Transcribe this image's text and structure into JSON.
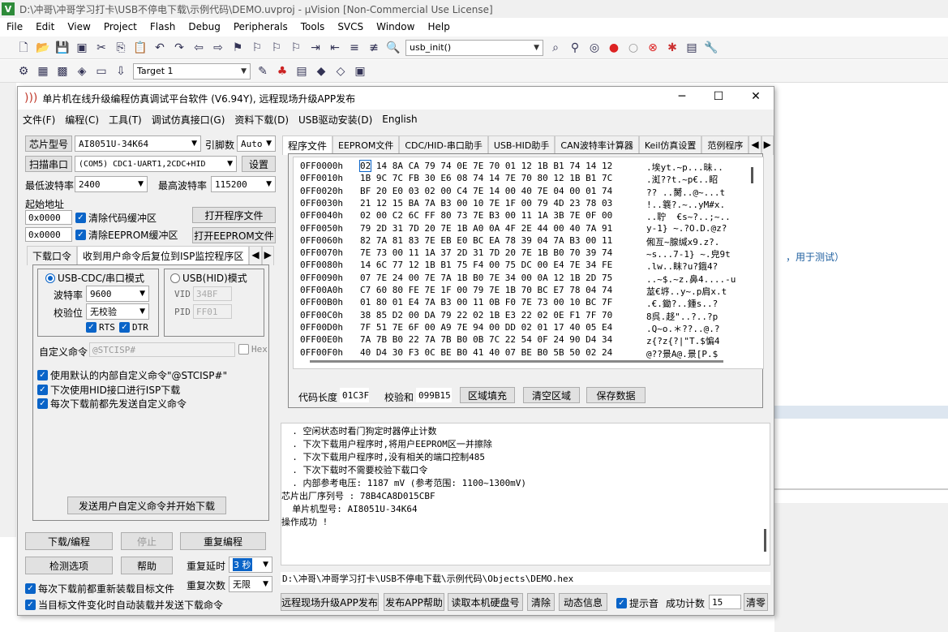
{
  "uvision": {
    "title": "D:\\冲哥\\冲哥学习打卡\\USB不停电下载\\示例代码\\DEMO.uvproj - µVision  [Non-Commercial Use License]",
    "menu": [
      "File",
      "Edit",
      "View",
      "Project",
      "Flash",
      "Debug",
      "Peripherals",
      "Tools",
      "SVCS",
      "Window",
      "Help"
    ],
    "func_combo": "usb_init()",
    "target": "Target 1",
    "right_note": "，用于测试）"
  },
  "isp": {
    "title": "单片机在线升级编程仿真调试平台软件 (V6.94Y), 远程现场升级APP发布",
    "menu": [
      "文件(F)",
      "编程(C)",
      "工具(T)",
      "调试仿真接口(G)",
      "资料下载(D)",
      "USB驱动安装(D)",
      "English"
    ],
    "chip_btn": "芯片型号",
    "chip_value": "AI8051U-34K64",
    "pins_label": "引脚数",
    "pins_value": "Auto",
    "scan_btn": "扫描串口",
    "port_value": "(COM5) CDC1-UART1,2CDC+HID",
    "settings_btn": "设置",
    "min_baud_label": "最低波特率",
    "min_baud": "2400",
    "max_baud_label": "最高波特率",
    "max_baud": "115200",
    "start_addr_label": "起始地址",
    "addr1": "0x0000",
    "clear_code": "清除代码缓冲区",
    "open_prog": "打开程序文件",
    "addr2": "0x0000",
    "clear_eeprom": "清除EEPROM缓冲区",
    "open_eeprom": "打开EEPROM文件",
    "left_tabs": [
      "下载口令",
      "收到用户命令后复位到ISP监控程序区"
    ],
    "mode_cdc": "USB-CDC/串口模式",
    "mode_hid": "USB(HID)模式",
    "baud_label": "波特率",
    "baud_value": "9600",
    "parity_label": "校验位",
    "parity_value": "无校验",
    "rts": "RTS",
    "dtr": "DTR",
    "vid_label": "VID",
    "vid_value": "34BF",
    "pid_label": "PID",
    "pid_value": "FF01",
    "custom_cmd_label": "自定义命令",
    "custom_cmd_value": "@STCISP#",
    "hex_label": "Hex",
    "opt1": "使用默认的内部自定义命令\"@STCISP#\"",
    "opt2": "下次使用HID接口进行ISP下载",
    "opt3": "每次下载前都先发送自定义命令",
    "send_btn": "发送用户自定义命令并开始下载",
    "download_btn": "下载/编程",
    "stop_btn": "停止",
    "reprog_btn": "重复编程",
    "check_btn": "检测选项",
    "help_btn": "帮助",
    "repeat_delay_label": "重复延时",
    "repeat_delay": "3 秒",
    "repeat_count_label": "重复次数",
    "repeat_count": "无限",
    "reload_opt": "每次下载前都重新装载目标文件",
    "auto_opt": "当目标文件变化时自动装载并发送下载命令",
    "right_tabs": [
      "程序文件",
      "EEPROM文件",
      "CDC/HID-串口助手",
      "USB-HID助手",
      "CAN波特率计算器",
      "Keil仿真设置",
      "范例程序"
    ],
    "hex_rows": [
      {
        "addr": "0FF0000h",
        "bytes": "02 14 8A CA 79 74 0E 7E 70 01 12 1B B1 74 14 12",
        "ascii": ".埃yt.~p...昧.."
      },
      {
        "addr": "0FF0010h",
        "bytes": "1B 9C 7C FB 30 E6 08 74 14 7E 70 80 12 1B B1 7C",
        "ascii": ".渱??t.~p€..眧"
      },
      {
        "addr": "0FF0020h",
        "bytes": "BF 20 E0 03 02 00 C4 7E 14 00 40 7E 04 00 01 74",
        "ascii": "?? ..膥..@~...t"
      },
      {
        "addr": "0FF0030h",
        "bytes": "21 12 15 BA 7A B3 00 10 7E 1F 00 79 4D 23 78 03",
        "ascii": "!..簔?.~..yM#x."
      },
      {
        "addr": "0FF0040h",
        "bytes": "02 00 C2 6C FF 80 73 7E B3 00 11 1A 3B 7E 0F 00",
        "ascii": "..聍  €s~?..;~.."
      },
      {
        "addr": "0FF0050h",
        "bytes": "79 2D 31 7D 20 7E 1B A0 0A 4F 2E 44 00 40 7A 91",
        "ascii": "y-1} ~.?O.D.@z?"
      },
      {
        "addr": "0FF0060h",
        "bytes": "82 7A 81 83 7E EB E0 BC EA 78 39 04 7A B3 00 11",
        "ascii": "俰亙~腺缄x9.z?."
      },
      {
        "addr": "0FF0070h",
        "bytes": "7E 73 00 11 1A 37 2D 31 7D 20 7E 1B B0 70 39 74",
        "ascii": "~s...7-1} ~.皃9t"
      },
      {
        "addr": "0FF0080h",
        "bytes": "14 6C 77 12 1B B1 75 F4 00 75 DC 00 E4 7E 34 FE",
        "ascii": ".lw..眜?u?鋨4?"
      },
      {
        "addr": "0FF0090h",
        "bytes": "07 7E 24 00 7E 7A 1B B0 7E 34 00 0A 12 1B 2D 75",
        "ascii": "..~$.~z.鼻4....-u"
      },
      {
        "addr": "0FF00A0h",
        "bytes": "C7 60 80 FE 7E 1F 00 79 7E 1B 70 BC E7 78 04 74",
        "ascii": "莁€垿..y~.p肩x.t"
      },
      {
        "addr": "0FF00B0h",
        "bytes": "01 80 01 E4 7A B3 00 11 0B F0 7E 73 00 10 BC 7F",
        "ascii": ".€.鋤?..鍾s..?"
      },
      {
        "addr": "0FF00C0h",
        "bytes": "38 85 D2 00 DA 79 22 02 1B E3 22 02 0E F1 7F 70",
        "ascii": "8呉.趍\"..?..?p"
      },
      {
        "addr": "0FF00D0h",
        "bytes": "7F 51 7E 6F 00 A9 7E 94 00 DD 02 01 17 40 05 E4",
        "ascii": ".Q~o.＊??..@.?"
      },
      {
        "addr": "0FF00E0h",
        "bytes": "7A 7B B0 22 7A 7B B0 0B 7C 22 54 0F 24 90 D4 34",
        "ascii": "z{?z{?|\"T.$惼4"
      },
      {
        "addr": "0FF00F0h",
        "bytes": "40 D4 30 F3 0C BE B0 41 40 07 BE B0 5B 50 02 24",
        "ascii": "@??景A@.景[P.$"
      }
    ],
    "code_len_label": "代码长度",
    "code_len": "01C3F",
    "checksum_label": "校验和",
    "checksum": "099B15",
    "fill_btn": "区域填充",
    "clear_btn": "清空区域",
    "save_btn": "保存数据",
    "log_lines": [
      "  . 空闲状态时看门狗定时器停止计数",
      "  . 下次下载用户程序时,将用户EEPROM区一并擦除",
      "  . 下次下载用户程序时,没有相关的端口控制485",
      "  . 下次下载时不需要校验下载口令",
      "  . 内部参考电压: 1187 mV (参考范围: 1100~1300mV)",
      "芯片出厂序列号 : 78B4CA8D015CBF",
      "",
      "  单片机型号: AI8051U-34K64",
      "",
      "操作成功 !"
    ],
    "hex_path": "D:\\冲哥\\冲哥学习打卡\\USB不停电下载\\示例代码\\Objects\\DEMO.hex",
    "bottom": {
      "remote_btn": "远程现场升级APP发布",
      "publish_help": "发布APP帮助",
      "read_disk": "读取本机硬盘号",
      "clear": "清除",
      "anim": "动态信息",
      "beep": "提示音",
      "success_label": "成功计数",
      "success_count": "15",
      "reset": "清零"
    }
  }
}
